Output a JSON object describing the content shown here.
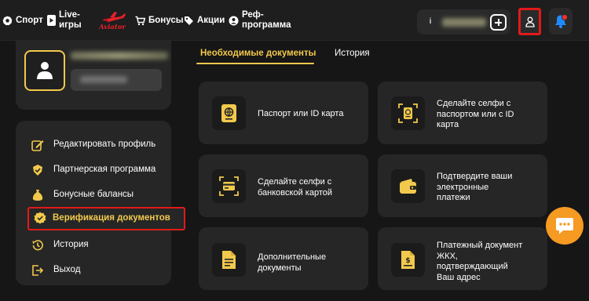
{
  "nav": {
    "sport": "Спорт",
    "live_line1": "Live-",
    "live_line2": "игры",
    "aviator": "Aviator",
    "bonuses": "Бонусы",
    "promos": "Акции",
    "referral_line1": "Реф-",
    "referral_line2": "программа"
  },
  "header": {
    "info_glyph": "i",
    "icons": [
      "info-icon",
      "plus-icon",
      "user-icon",
      "bell-icon"
    ]
  },
  "menu": {
    "items": [
      {
        "label": "Редактировать профиль",
        "icon": "edit-icon"
      },
      {
        "label": "Партнерская программа",
        "icon": "partner-icon"
      },
      {
        "label": "Бонусные балансы",
        "icon": "money-bag-icon"
      },
      {
        "label": "Верификация документов",
        "icon": "verified-badge-icon",
        "active": true
      },
      {
        "label": "История",
        "icon": "history-icon"
      },
      {
        "label": "Выход",
        "icon": "logout-icon"
      }
    ]
  },
  "tabs": {
    "required_docs": "Необходимые документы",
    "history": "История"
  },
  "documents": [
    {
      "line1": "Паспорт или ID карта",
      "line2": "",
      "line3": "",
      "icon": "passport-icon"
    },
    {
      "line1": "Сделайте селфи с",
      "line2": "паспортом или с ID",
      "line3": "карта",
      "icon": "passport-scan-icon"
    },
    {
      "line1": "Сделайте селфи с",
      "line2": "банковской картой",
      "line3": "",
      "icon": "card-scan-icon"
    },
    {
      "line1": "Подтвердите ваши",
      "line2": "электронные",
      "line3": "платежи",
      "icon": "wallet-icon"
    },
    {
      "line1": "Дополнительные",
      "line2": "документы",
      "line3": "",
      "icon": "document-icon"
    },
    {
      "line1": "Платежный документ",
      "line2": "ЖКХ,",
      "line3": "подтверждающий",
      "line4": "Ваш адрес",
      "icon": "bill-icon"
    }
  ],
  "colors": {
    "accent": "#f2c94c",
    "highlight": "#e21a1a",
    "chat": "#f59a23",
    "background": "#161616",
    "card": "#262626"
  }
}
